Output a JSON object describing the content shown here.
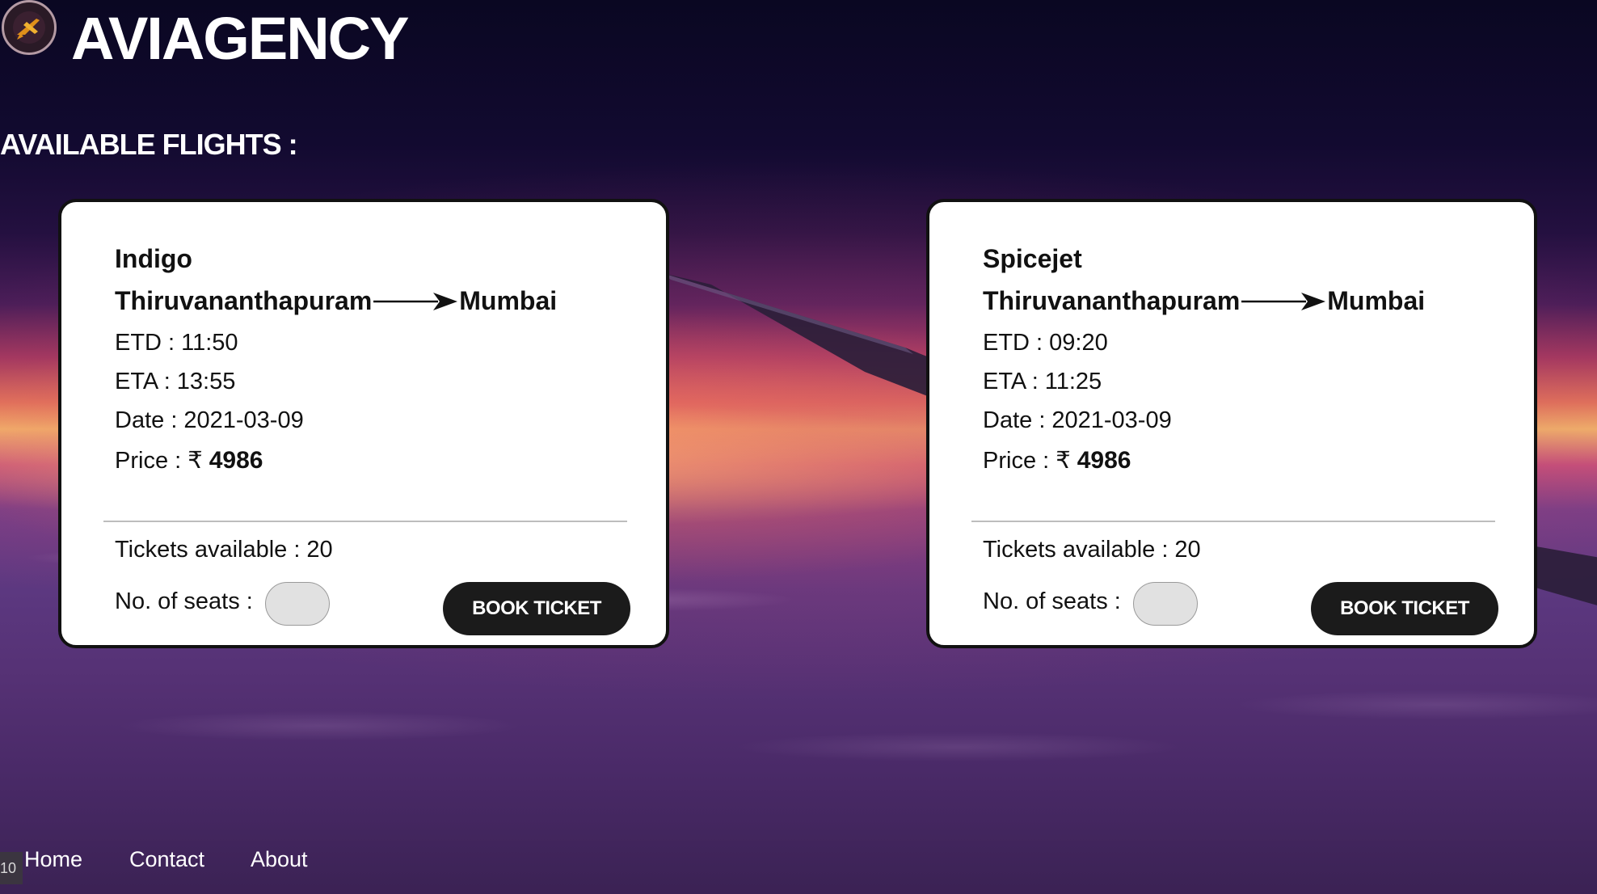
{
  "brand": {
    "name": "AVIAGENCY",
    "logo_icon": "airplane-logo-icon"
  },
  "section_title": "AVAILABLE FLIGHTS :",
  "flights": [
    {
      "airline": "Indigo",
      "from": "Thiruvananthapuram",
      "to": "Mumbai",
      "etd_label": "ETD :",
      "etd": "11:50",
      "eta_label": "ETA :",
      "eta": "13:55",
      "date_label": "Date :",
      "date": "2021-03-09",
      "price_label": "Price :",
      "currency": "₹",
      "price": "4986",
      "tickets_label": "Tickets available :",
      "tickets": "20",
      "seats_label": "No. of seats :",
      "seats_value": "",
      "book_label": "BOOK TICKET"
    },
    {
      "airline": "Spicejet",
      "from": "Thiruvananthapuram",
      "to": "Mumbai",
      "etd_label": "ETD :",
      "etd": "09:20",
      "eta_label": "ETA :",
      "eta": "11:25",
      "date_label": "Date :",
      "date": "2021-03-09",
      "price_label": "Price :",
      "currency": "₹",
      "price": "4986",
      "tickets_label": "Tickets available :",
      "tickets": "20",
      "seats_label": "No. of seats :",
      "seats_value": "",
      "book_label": "BOOK TICKET"
    }
  ],
  "nav": {
    "home": "Home",
    "contact": "Contact",
    "about": "About"
  },
  "corner_tag": "10",
  "colors": {
    "card_bg": "#ffffff",
    "button_bg": "#1b1b1b",
    "input_bg": "#e1e1e1",
    "text_light": "#ffffff"
  }
}
